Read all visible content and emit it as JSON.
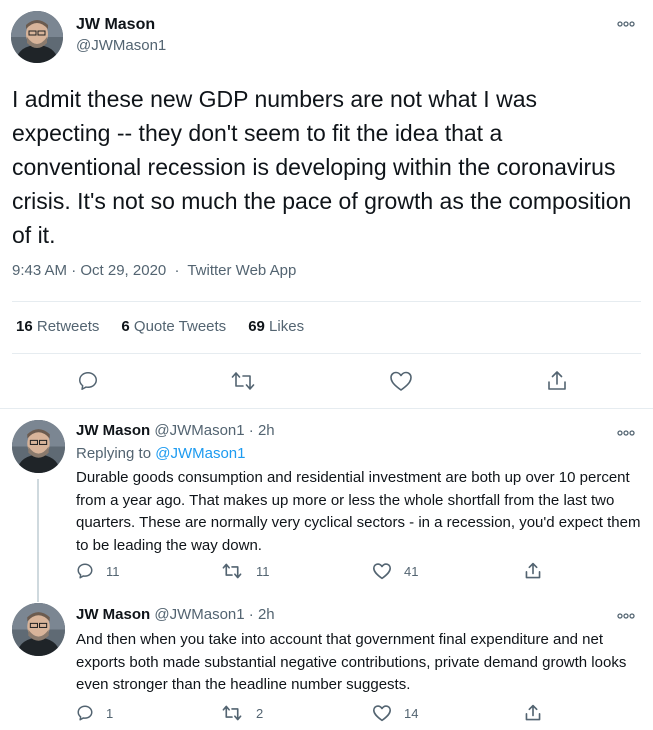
{
  "main": {
    "display_name": "JW Mason",
    "handle": "@JWMason1",
    "text": "I admit these new GDP numbers are not what I was expecting -- they don't seem to fit the idea that a conventional recession is developing within the coronavirus crisis. It's not so much the pace of growth as the composition of it.",
    "time": "9:43 AM · Oct 29, 2020",
    "source_sep": "·",
    "source": "Twitter Web App",
    "stats": {
      "retweets_count": "16",
      "retweets_label": "Retweets",
      "quotes_count": "6",
      "quotes_label": "Quote Tweets",
      "likes_count": "69",
      "likes_label": "Likes"
    }
  },
  "replies": [
    {
      "display_name": "JW Mason",
      "handle": "@JWMason1",
      "time": "· 2h",
      "replying_label": "Replying to",
      "replying_handle": "@JWMason1",
      "text": "Durable goods consumption and residential investment are both up over 10 percent from a year ago. That makes up more or less the whole shortfall from the last two quarters. These are normally very cyclical sectors - in a recession, you'd expect them to be leading the way down.",
      "reply_count": "11",
      "retweet_count": "11",
      "like_count": "41"
    },
    {
      "display_name": "JW Mason",
      "handle": "@JWMason1",
      "time": "· 2h",
      "text": "And then when you take into account that government final expenditure and net exports both made substantial negative contributions, private demand growth looks even stronger than the headline number suggests.",
      "reply_count": "1",
      "retweet_count": "2",
      "like_count": "14"
    }
  ],
  "icons": {
    "more": "more-icon",
    "reply": "reply-icon",
    "retweet": "retweet-icon",
    "like": "heart-icon",
    "share": "share-icon"
  },
  "colors": {
    "text": "#0f1419",
    "muted": "#536471",
    "link": "#1d9bf0",
    "divider": "#e6ecf0"
  }
}
